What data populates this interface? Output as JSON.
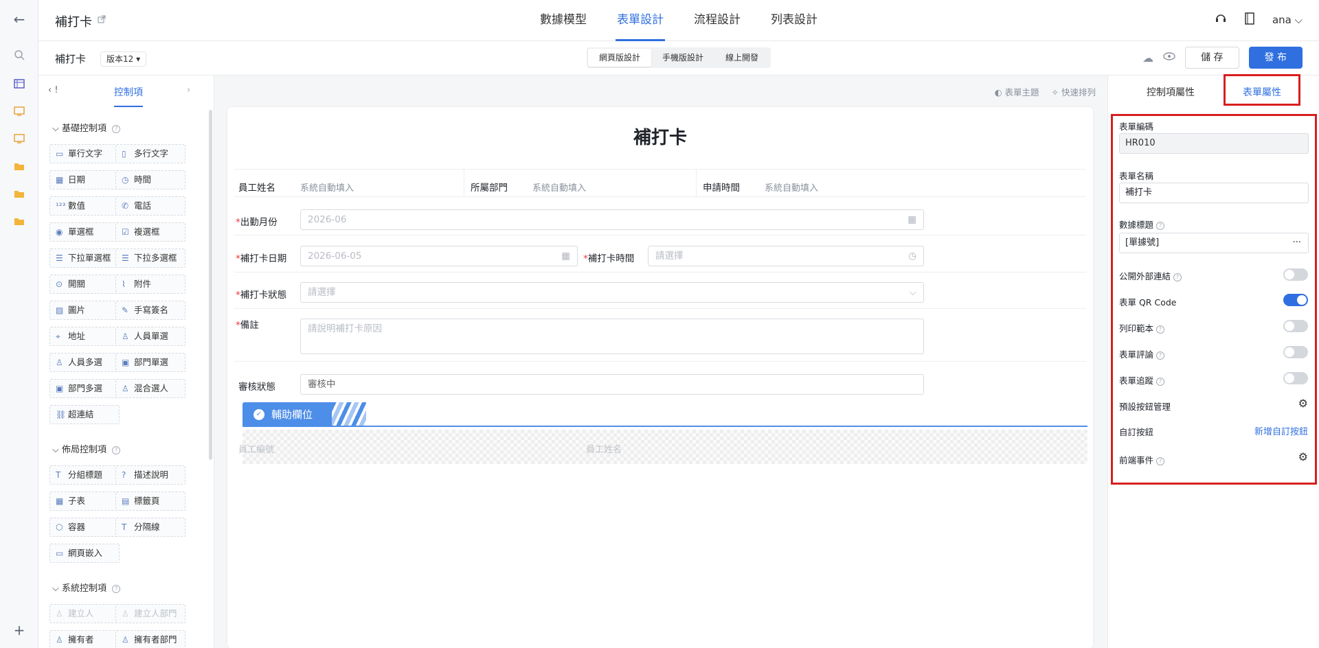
{
  "app": {
    "title": "補打卡",
    "user": "ana"
  },
  "nav": {
    "tabs": [
      "數據模型",
      "表單設計",
      "流程設計",
      "列表設計"
    ],
    "active": 1
  },
  "subbar": {
    "form_title": "補打卡",
    "version": "版本12",
    "modes": [
      "網頁版設計",
      "手機版設計",
      "線上開發"
    ],
    "save": "儲 存",
    "publish": "發 布"
  },
  "left": {
    "tab_label": "控制項",
    "basic_title": "基礎控制項",
    "basic": [
      "單行文字",
      "多行文字",
      "日期",
      "時間",
      "數值",
      "電話",
      "單選框",
      "複選框",
      "下拉單選框",
      "下拉多選框",
      "開關",
      "附件",
      "圖片",
      "手寫簽名",
      "地址",
      "人員單選",
      "人員多選",
      "部門單選",
      "部門多選",
      "混合選人",
      "超連結"
    ],
    "layout_title": "佈局控制項",
    "layout": [
      "分組標題",
      "描述說明",
      "子表",
      "標籤頁",
      "容器",
      "分隔線",
      "網頁嵌入"
    ],
    "system_title": "系統控制項",
    "system": [
      "建立人",
      "建立人部門",
      "擁有者",
      "擁有者部門"
    ]
  },
  "canvas": {
    "theme": "表單主題",
    "arrange": "快速排列",
    "form_title": "補打卡",
    "row1": [
      {
        "label": "員工姓名",
        "value": "系統自動填入"
      },
      {
        "label": "所屬部門",
        "value": "系統自動填入"
      },
      {
        "label": "申請時間",
        "value": "系統自動填入"
      }
    ],
    "month": {
      "label": "出勤月份",
      "placeholder": "2026-06"
    },
    "date": {
      "label": "補打卡日期",
      "placeholder": "2026-06-05"
    },
    "time": {
      "label": "補打卡時間",
      "placeholder": "請選擇"
    },
    "status": {
      "label": "補打卡狀態",
      "placeholder": "請選擇"
    },
    "note": {
      "label": "備註",
      "placeholder": "請說明補打卡原因"
    },
    "review": {
      "label": "審核狀態",
      "value": "審核中"
    },
    "aux": {
      "label": "輔助欄位",
      "f1": "員工編號",
      "f2": "員工姓名"
    }
  },
  "right": {
    "tab1": "控制項屬性",
    "tab2": "表單屬性",
    "code_label": "表單編碼",
    "code": "HR010",
    "name_label": "表單名稱",
    "name": "補打卡",
    "datatitle_label": "數據標題",
    "datatitle": "[單據號]",
    "toggles": [
      {
        "label": "公開外部連結",
        "on": false
      },
      {
        "label": "表單 QR Code",
        "on": true
      },
      {
        "label": "列印範本",
        "on": false
      },
      {
        "label": "表單評論",
        "on": false
      },
      {
        "label": "表單追蹤",
        "on": false
      }
    ],
    "default_btn": "預設按鈕管理",
    "custom_btn": "自訂按鈕",
    "add_custom": "新增自訂按鈕",
    "frontend": "前端事件"
  }
}
